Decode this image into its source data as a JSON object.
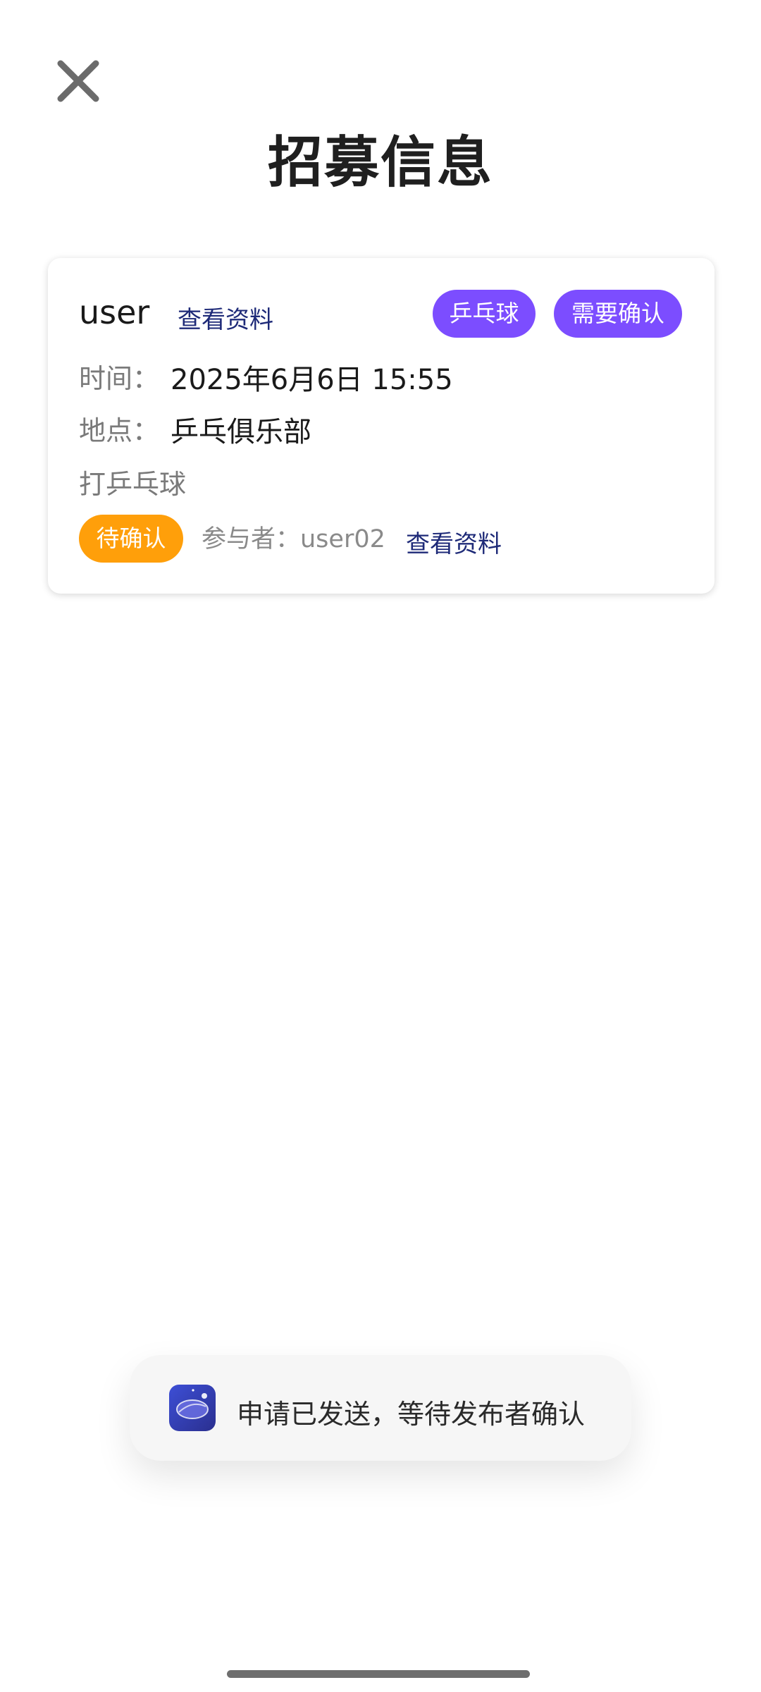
{
  "header": {
    "close_icon": "close-icon",
    "title": "招募信息"
  },
  "recruit_card": {
    "publisher": "user",
    "view_profile_label": "查看资料",
    "tags": {
      "sport": "乒乓球",
      "confirm": "需要确认"
    },
    "time_label": "时间：",
    "time_value": "2025年6月6日 15:55",
    "place_label": "地点：",
    "place_value": "乒乓俱乐部",
    "description": "打乒乓球",
    "status": "待确认",
    "participant_text": "参与者：user02",
    "participant_view_profile_label": "查看资料"
  },
  "toast": {
    "icon": "app-icon",
    "message": "申请已发送，等待发布者确认"
  },
  "colors": {
    "accent_purple": "#7c4dff",
    "status_orange": "#ff9f0a",
    "link_navy": "#1e2a78"
  }
}
